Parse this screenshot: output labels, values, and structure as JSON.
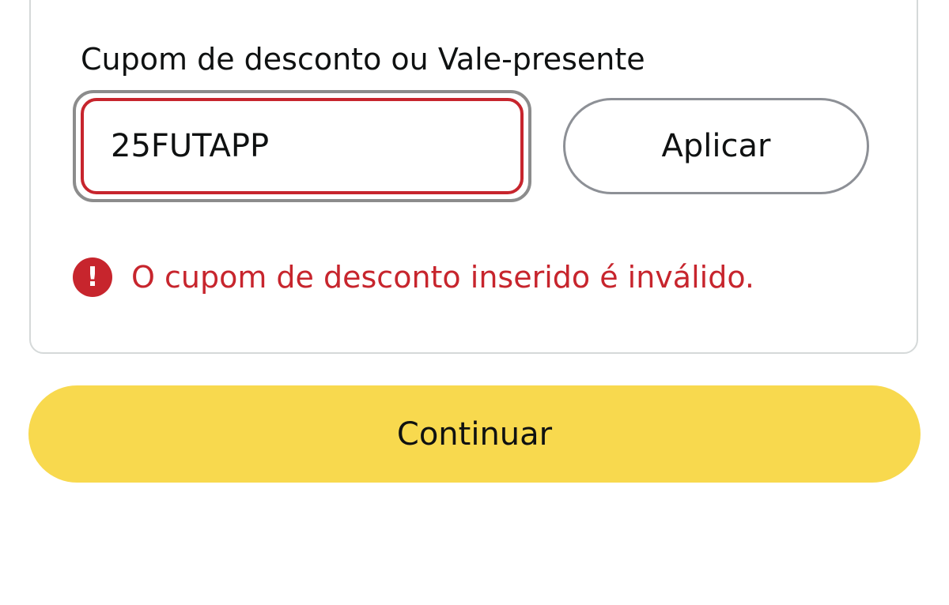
{
  "coupon_form": {
    "label": "Cupom de desconto ou Vale-presente",
    "input_value": "25FUTAPP",
    "apply_label": "Aplicar",
    "error_icon_glyph": "!",
    "error_message": "O cupom de desconto inserido é inválido."
  },
  "continue_label": "Continuar",
  "colors": {
    "error": "#c7252d",
    "primary_button": "#f8d94e",
    "text": "#0f1111"
  },
  "icons": {
    "error_icon": "exclamation-circle-icon"
  }
}
